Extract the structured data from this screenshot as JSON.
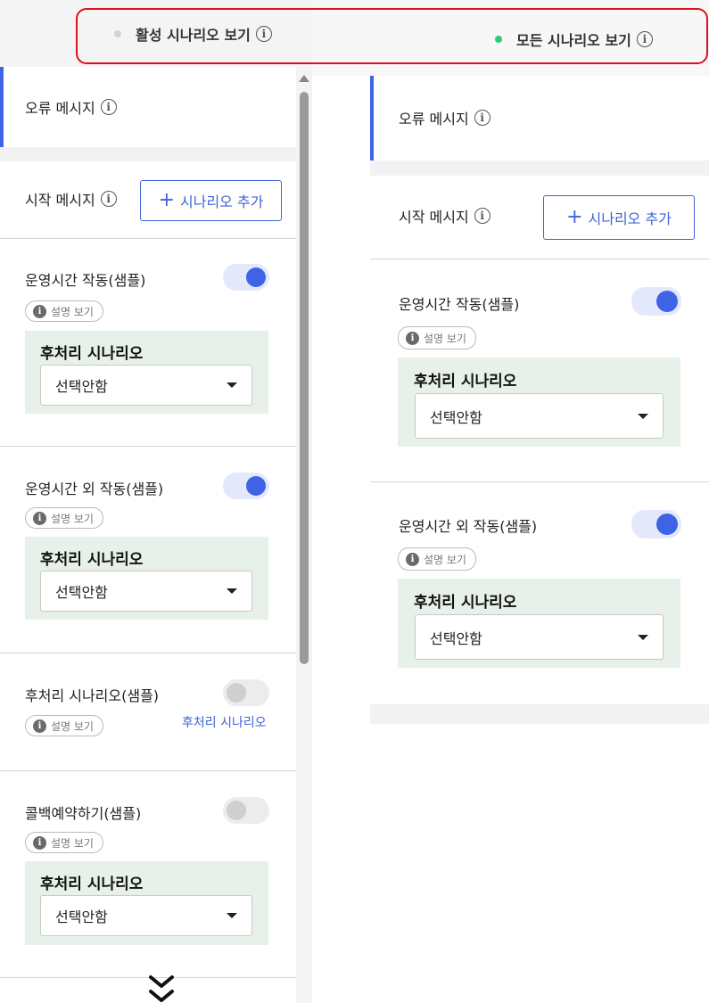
{
  "header": {
    "active_option": {
      "label": "활성 시나리오 보기",
      "dot_color": "#d3d3d3"
    },
    "all_option": {
      "label": "모든 시나리오 보기",
      "dot_color": "#2ecc71"
    },
    "info_glyph": "i",
    "highlight_color": "#d9121f"
  },
  "common": {
    "error_message_label": "오류 메시지",
    "start_message_label": "시작 메시지",
    "add_scenario_button": "+ 시나리오 추가",
    "add_plus": "+",
    "add_text": "시나리오 추가",
    "desc_pill_label": "설명 보기",
    "post_scenario_label": "후처리 시나리오",
    "select_value": "선택안함",
    "accent_color": "#3f63e6"
  },
  "left_panel": {
    "cards": [
      {
        "title": "운영시간 작동(샘플)",
        "enabled": true
      },
      {
        "title": "운영시간 외 작동(샘플)",
        "enabled": true
      },
      {
        "title": "후처리 시나리오(샘플)",
        "enabled": false,
        "link": "후처리 시나리오"
      },
      {
        "title": "콜백예약하기(샘플)",
        "enabled": false
      }
    ],
    "more_icon": "double-chevron-down-icon"
  },
  "right_panel": {
    "cards": [
      {
        "title": "운영시간 작동(샘플)",
        "enabled": true
      },
      {
        "title": "운영시간 외 작동(샘플)",
        "enabled": true
      }
    ]
  }
}
